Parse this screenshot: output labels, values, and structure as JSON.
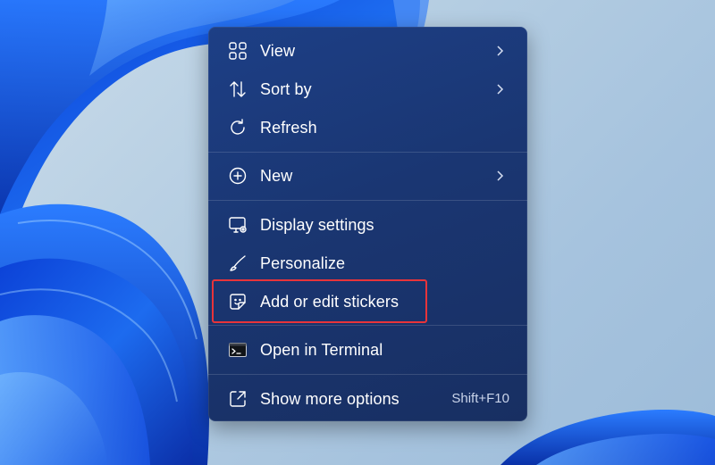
{
  "menu": {
    "items": [
      {
        "label": "View",
        "icon": "grid-icon",
        "has_submenu": true
      },
      {
        "label": "Sort by",
        "icon": "sort-icon",
        "has_submenu": true
      },
      {
        "label": "Refresh",
        "icon": "refresh-icon",
        "has_submenu": false
      },
      {
        "label": "New",
        "icon": "plus-circle-icon",
        "has_submenu": true
      },
      {
        "label": "Display settings",
        "icon": "display-settings-icon",
        "has_submenu": false
      },
      {
        "label": "Personalize",
        "icon": "brush-icon",
        "has_submenu": false
      },
      {
        "label": "Add or edit stickers",
        "icon": "sticker-icon",
        "has_submenu": false,
        "highlighted": true
      },
      {
        "label": "Open in Terminal",
        "icon": "terminal-icon",
        "has_submenu": false
      },
      {
        "label": "Show more options",
        "icon": "expand-icon",
        "has_submenu": false,
        "shortcut": "Shift+F10"
      }
    ]
  },
  "colors": {
    "menu_background": "#1a3672",
    "highlight_border": "#e8343a",
    "text": "#ffffff"
  }
}
